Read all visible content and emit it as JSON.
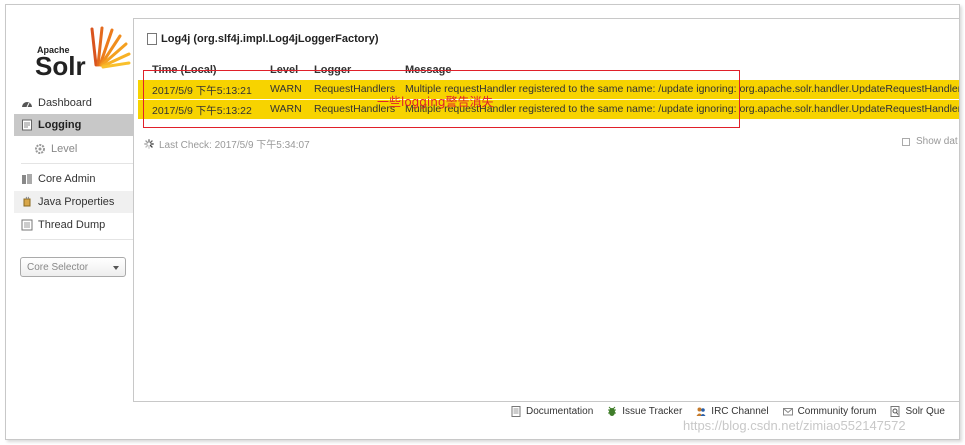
{
  "logo": {
    "apache": "Apache",
    "solr": "Solr"
  },
  "sidebar": {
    "items": [
      {
        "label": "Dashboard"
      },
      {
        "label": "Logging"
      },
      {
        "label": "Level"
      },
      {
        "label": "Core Admin"
      },
      {
        "label": "Java Properties"
      },
      {
        "label": "Thread Dump"
      }
    ],
    "core_selector": "Core Selector"
  },
  "content": {
    "title": "Log4j (org.slf4j.impl.Log4jLoggerFactory)",
    "columns": [
      "Time (Local)",
      "Level",
      "Logger",
      "Message"
    ],
    "rows": [
      {
        "time": "2017/5/9 下午5:13:21",
        "level": "WARN",
        "logger": "RequestHandlers",
        "message": "Multiple requestHandler registered to the same name: /update ignoring: org.apache.solr.handler.UpdateRequestHandler"
      },
      {
        "time": "2017/5/9 下午5:13:22",
        "level": "WARN",
        "logger": "RequestHandlers",
        "message": "Multiple requestHandler registered to the same name: /update ignoring: org.apache.solr.handler.UpdateRequestHandler"
      }
    ],
    "annotation": "一些logging警告消失",
    "last_check": "Last Check: 2017/5/9 下午5:34:07",
    "show_data": "Show dat"
  },
  "footer": {
    "links": [
      "Documentation",
      "Issue Tracker",
      "IRC Channel",
      "Community forum",
      "Solr Que"
    ]
  },
  "watermark": "https://blog.csdn.net/zimiao552147572",
  "colors": {
    "warn_row": "#f7d300",
    "annotation": "#e0202a",
    "active_nav": "#c8c8c8"
  }
}
